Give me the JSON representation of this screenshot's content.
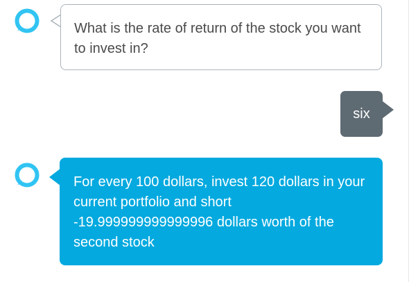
{
  "conversation": {
    "messages": [
      {
        "sender": "assistant",
        "style": "outlined",
        "avatar_icon": "alexa-ring-icon",
        "text": "What is the rate of return of the stock you want to invest in?"
      },
      {
        "sender": "user",
        "style": "filled-gray",
        "text": "six"
      },
      {
        "sender": "assistant",
        "style": "filled-blue",
        "avatar_icon": "alexa-ring-icon",
        "text": "For every 100 dollars, invest 120 dollars in your current portfolio and short -19.999999999999996 dollars worth of the second stock"
      }
    ]
  },
  "colors": {
    "assistant_accent": "#03a9df",
    "user_bubble": "#5f6b73",
    "outline_border": "#aab4bb",
    "outline_text": "#4a4a4a"
  }
}
